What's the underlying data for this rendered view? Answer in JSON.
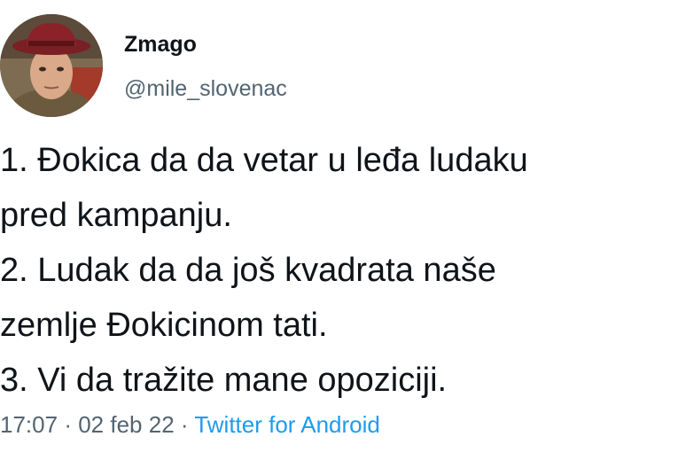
{
  "tweet": {
    "author": {
      "display_name": "Zmago",
      "handle": "@mile_slovenac"
    },
    "text_lines": [
      "1. Đokica da da vetar u leđa ludaku",
      "pred kampanju.",
      "2. Ludak da da još kvadrata naše",
      "zemlje Đokicinom tati.",
      "3. Vi da tražite mane opoziciji."
    ],
    "time": "17:07",
    "date": "02 feb 22",
    "separator": "·",
    "source": "Twitter for Android"
  },
  "colors": {
    "text": "#0f1419",
    "secondary": "#536471",
    "link": "#1d9bf0",
    "background": "#ffffff"
  }
}
